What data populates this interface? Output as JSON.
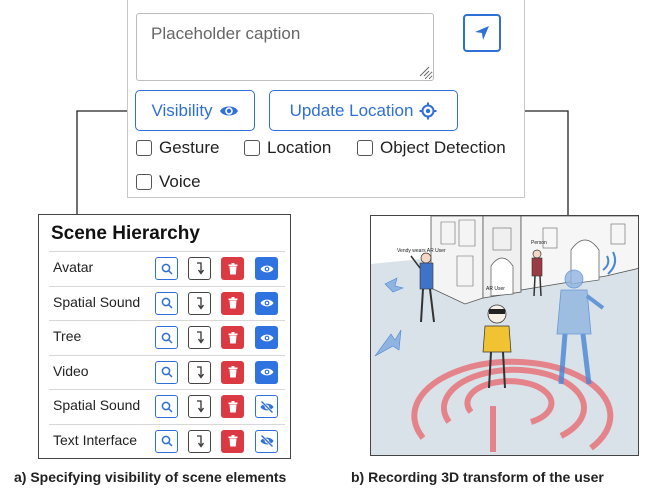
{
  "panel": {
    "caption_placeholder": "Placeholder caption",
    "visibility_label": "Visibility",
    "update_location_label": "Update Location",
    "checkboxes": [
      "Gesture",
      "Location",
      "Object Detection",
      "Voice"
    ]
  },
  "hierarchy": {
    "title": "Scene Hierarchy",
    "items": [
      {
        "name": "Avatar",
        "visible": true
      },
      {
        "name": "Spatial Sound",
        "visible": true
      },
      {
        "name": "Tree",
        "visible": true
      },
      {
        "name": "Video",
        "visible": true
      },
      {
        "name": "Spatial Sound",
        "visible": false
      },
      {
        "name": "Text Interface",
        "visible": false
      }
    ]
  },
  "scene": {
    "label_vendor": "Vendy wears AR User",
    "label_user": "AR User",
    "label_person": "Person"
  },
  "captions": {
    "a": "a) Specifying visibility of scene elements",
    "b": "b) Recording 3D transform of the user"
  },
  "colors": {
    "accent": "#2f6fd8",
    "delete": "#dc3a43",
    "ring": "#e8737a"
  }
}
